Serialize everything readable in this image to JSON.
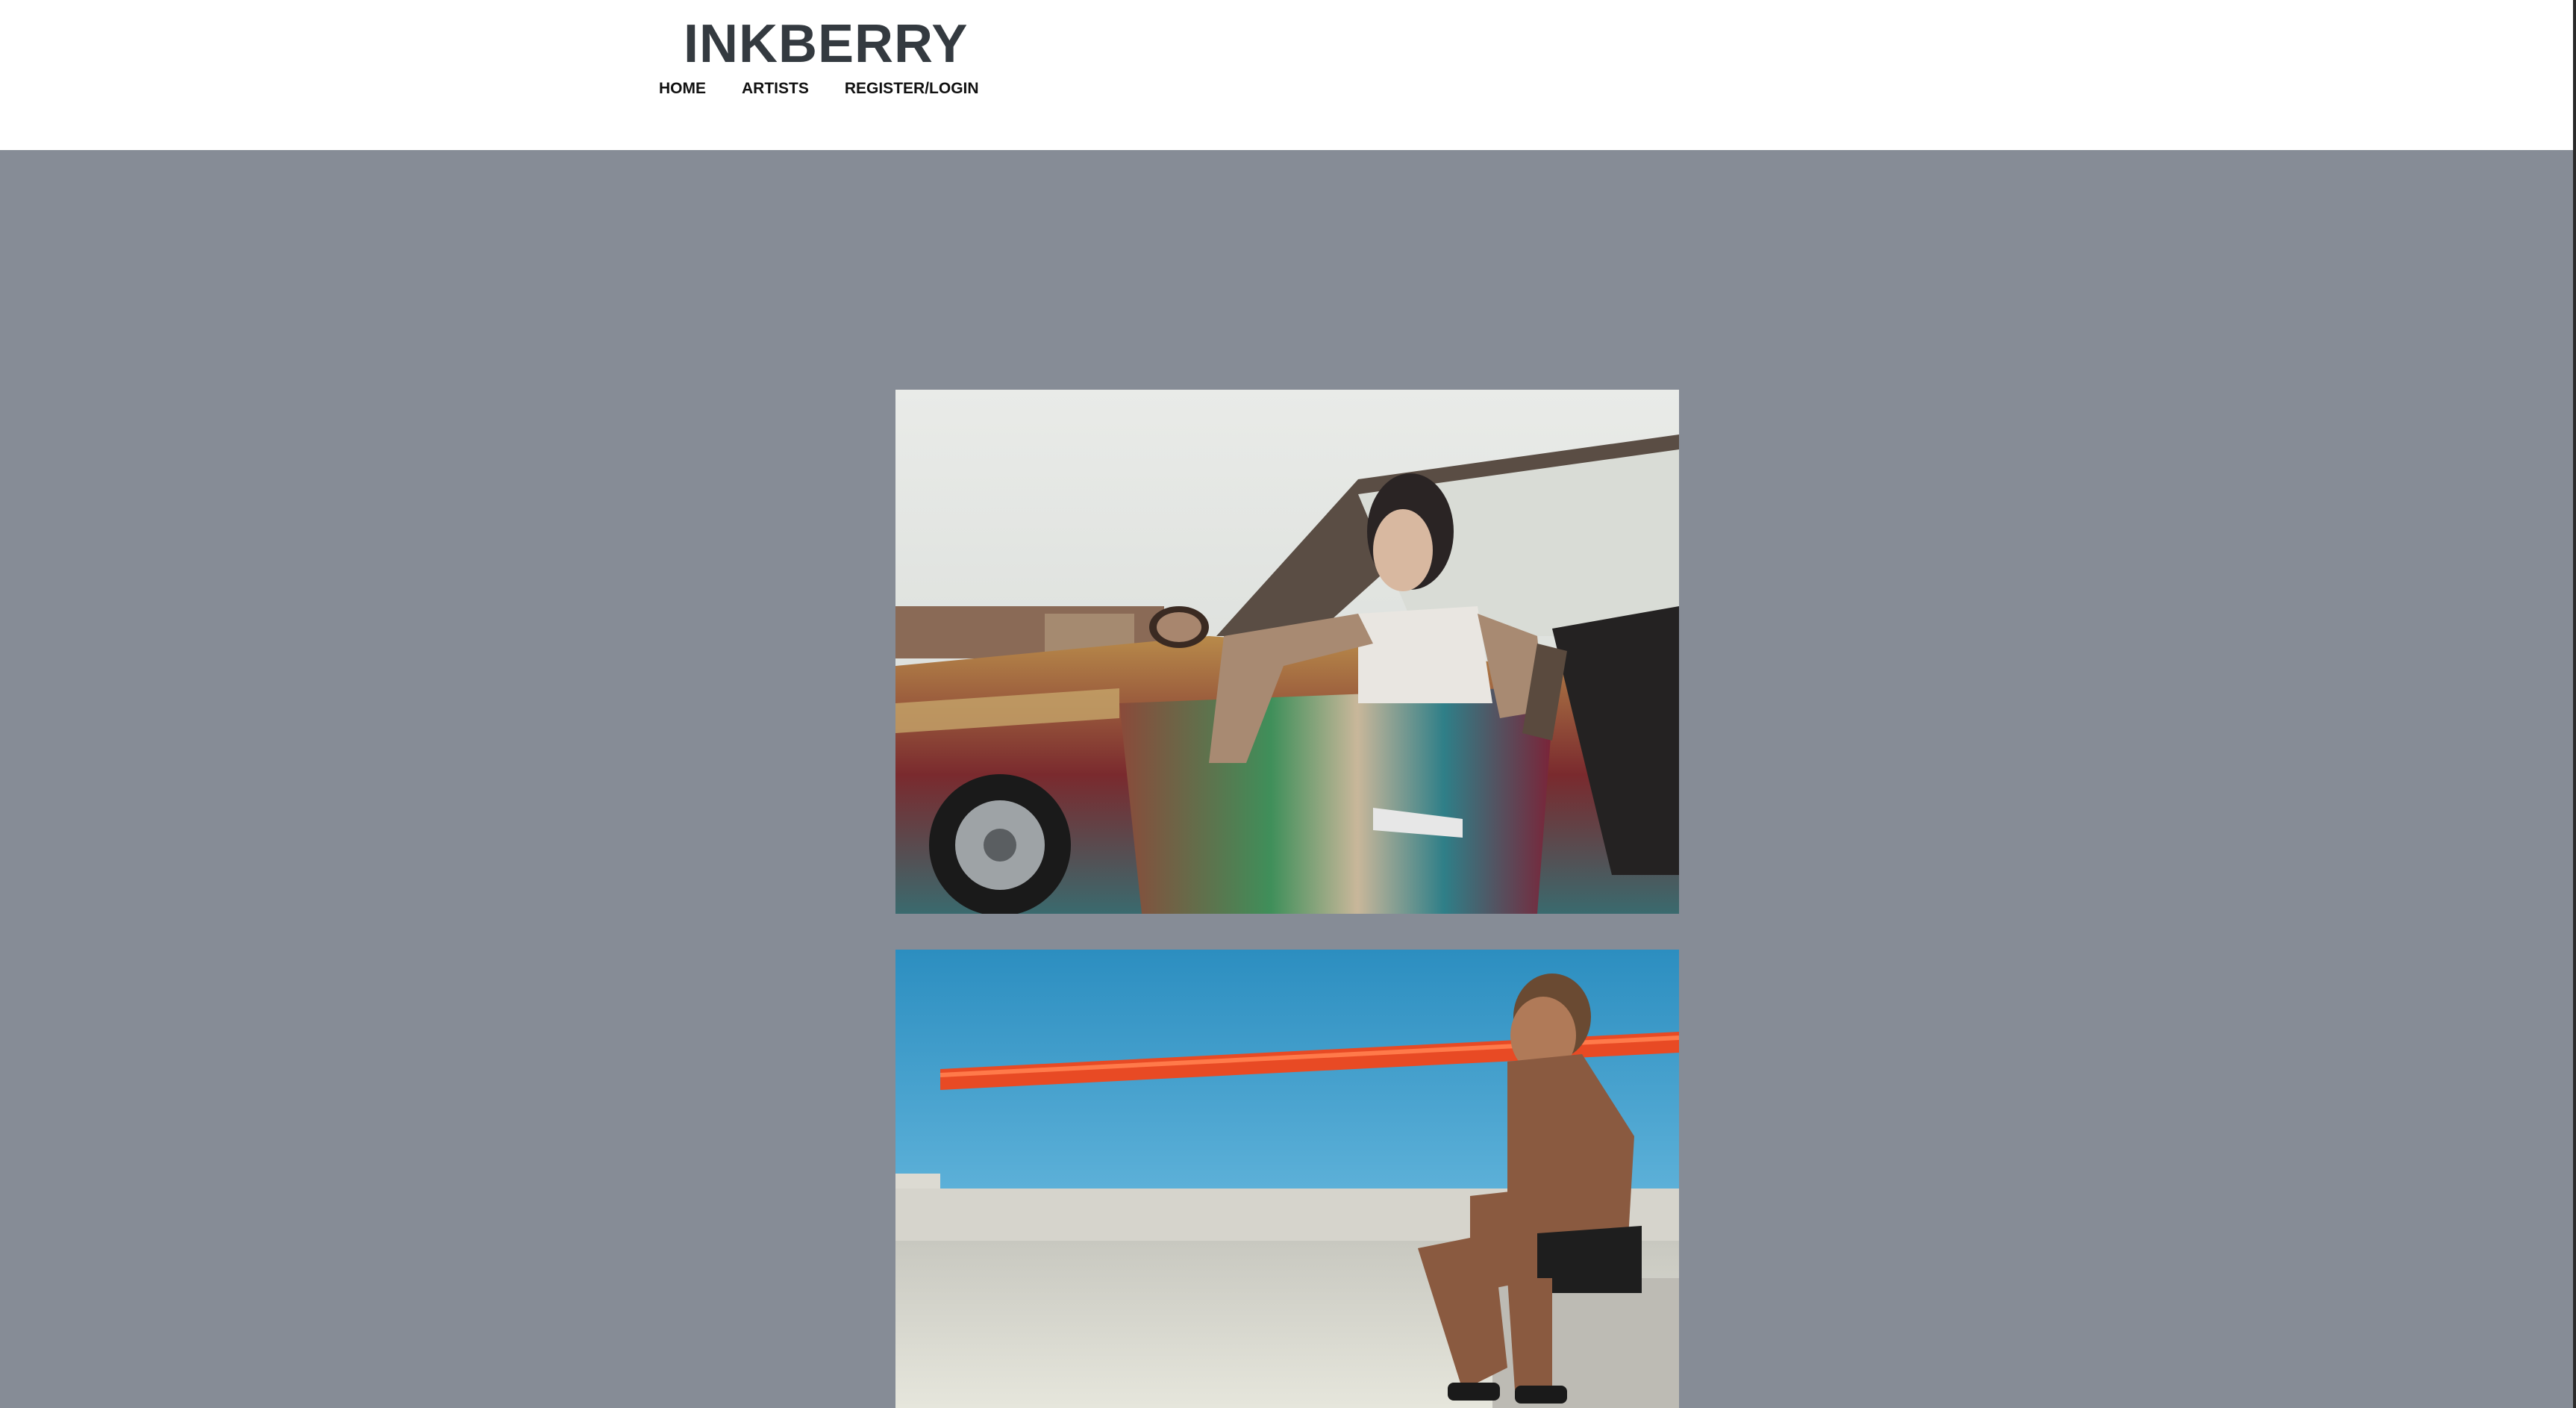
{
  "header": {
    "brand": "INKBERRY",
    "nav": [
      {
        "label": "HOME"
      },
      {
        "label": "ARTISTS"
      },
      {
        "label": "REGISTER/LOGIN"
      }
    ]
  },
  "colors": {
    "page_bg": "#868c96",
    "header_bg": "#ffffff",
    "brand_text": "#343a40"
  },
  "gallery": {
    "photos": [
      {
        "subject": "tattooed woman leaning out of painted lowrider car door"
      },
      {
        "subject": "heavily tattooed man sitting on concrete ledge by the sea"
      }
    ]
  }
}
